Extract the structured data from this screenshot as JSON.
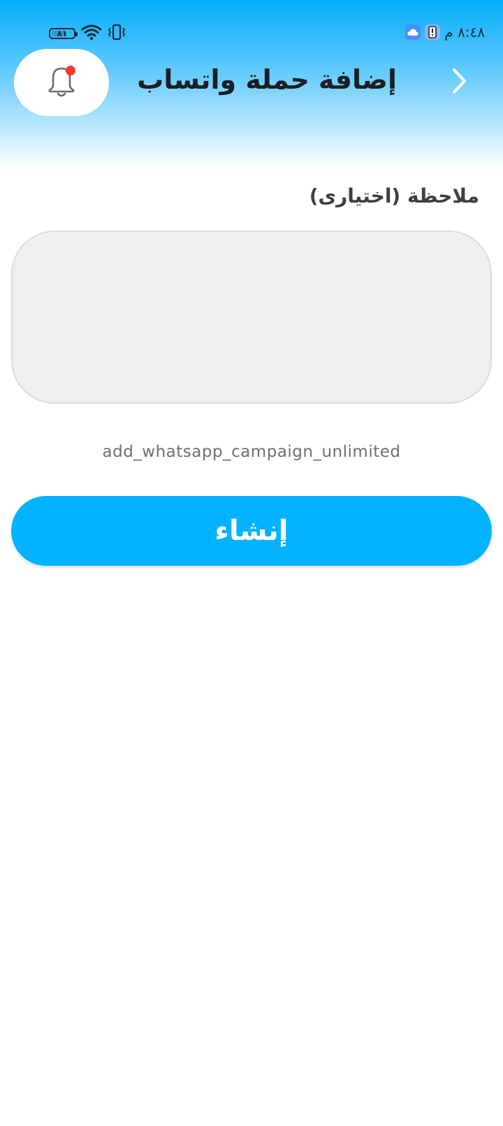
{
  "status_bar": {
    "time": "٨:٤٨ م",
    "battery": "٨١",
    "icons": [
      "battery-icon",
      "wifi-icon",
      "vibrate-icon",
      "app-notification-icon",
      "cloud-icon"
    ]
  },
  "header": {
    "title": "إضافة حملة واتساب",
    "back_icon": "chevron-right-icon",
    "bell_icon": "bell-icon",
    "accent_color": "#04b3ff"
  },
  "form": {
    "note_label": "ملاحظة (اختيارى)",
    "note_value": "",
    "note_placeholder": "",
    "helper_text": "add_whatsapp_campaign_unlimited",
    "create_label": "إنشاء"
  }
}
